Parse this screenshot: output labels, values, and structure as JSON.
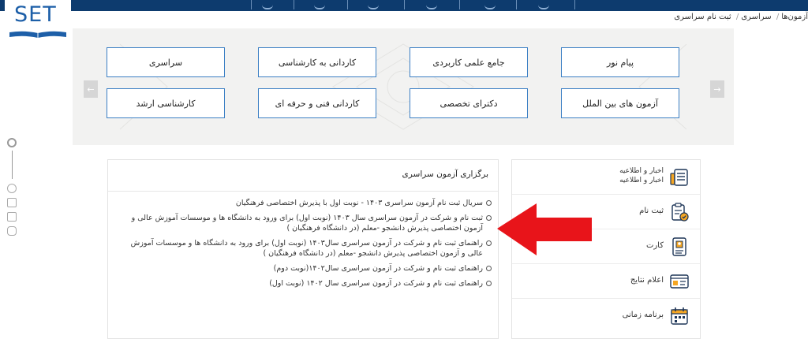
{
  "logo": {
    "text": "SET"
  },
  "breadcrumb": {
    "items": [
      "آزمون‌ها",
      "سراسری",
      "ثبت نام سراسری"
    ],
    "separator": "/"
  },
  "tiles": {
    "row1": [
      "پیام نور",
      "جامع علمی کاربردی",
      "کاردانی به کارشناسی",
      "سراسری"
    ],
    "row2": [
      "آزمون های بین الملل",
      "دکترای تخصصی",
      "کاردانی فنی و حرفه ای",
      "کارشناسی ارشد"
    ]
  },
  "carousel": {
    "prev": "←",
    "next": "→"
  },
  "content": {
    "title": "برگزاری آزمون سراسری",
    "items": [
      "سریال ثبت نام آزمون سراسری ۱۴۰۳ - نوبت اول با پذیرش اختصاصی فرهنگیان",
      "ثبت نام و شرکت در آزمون سراسری سال ۱۴۰۳ (نوبت اول) برای ورود به دانشگاه ها و موسسات آموزش عالی و آزمون اختصاصی پذیرش دانشجو -معلم (در دانشگاه فرهنگیان )",
      "راهنمای ثبت نام و شرکت در آزمون سراسری سال۱۴۰۳ (نوبت اول) برای ورود به دانشگاه ها و موسسات آموزش عالی و آزمون اختصاصی پذیرش دانشجو -معلم (در دانشگاه فرهنگیان )",
      "راهنمای ثبت نام و شرکت در آزمون سراسری سال۱۴۰۲(نوبت دوم)",
      "راهنمای ثبت نام و شرکت در آزمون سراسری سال ۱۴۰۲ (نوبت اول)"
    ]
  },
  "menu": {
    "items": [
      {
        "label": "اخبار و اطلاعیه",
        "sublabel": "اخبار و اطلاعیه",
        "icon": "news-icon"
      },
      {
        "label": "ثبت نام",
        "icon": "registration-icon"
      },
      {
        "label": "کارت",
        "icon": "card-icon"
      },
      {
        "label": "اعلام نتایج",
        "icon": "results-icon"
      },
      {
        "label": "برنامه زمانی",
        "icon": "calendar-icon"
      }
    ]
  },
  "colors": {
    "navy": "#0d3b6e",
    "tile_border": "#3b7fc4",
    "arrow": "#e8141a",
    "icon_blue": "#1d5fa8",
    "icon_orange": "#f5a623"
  }
}
